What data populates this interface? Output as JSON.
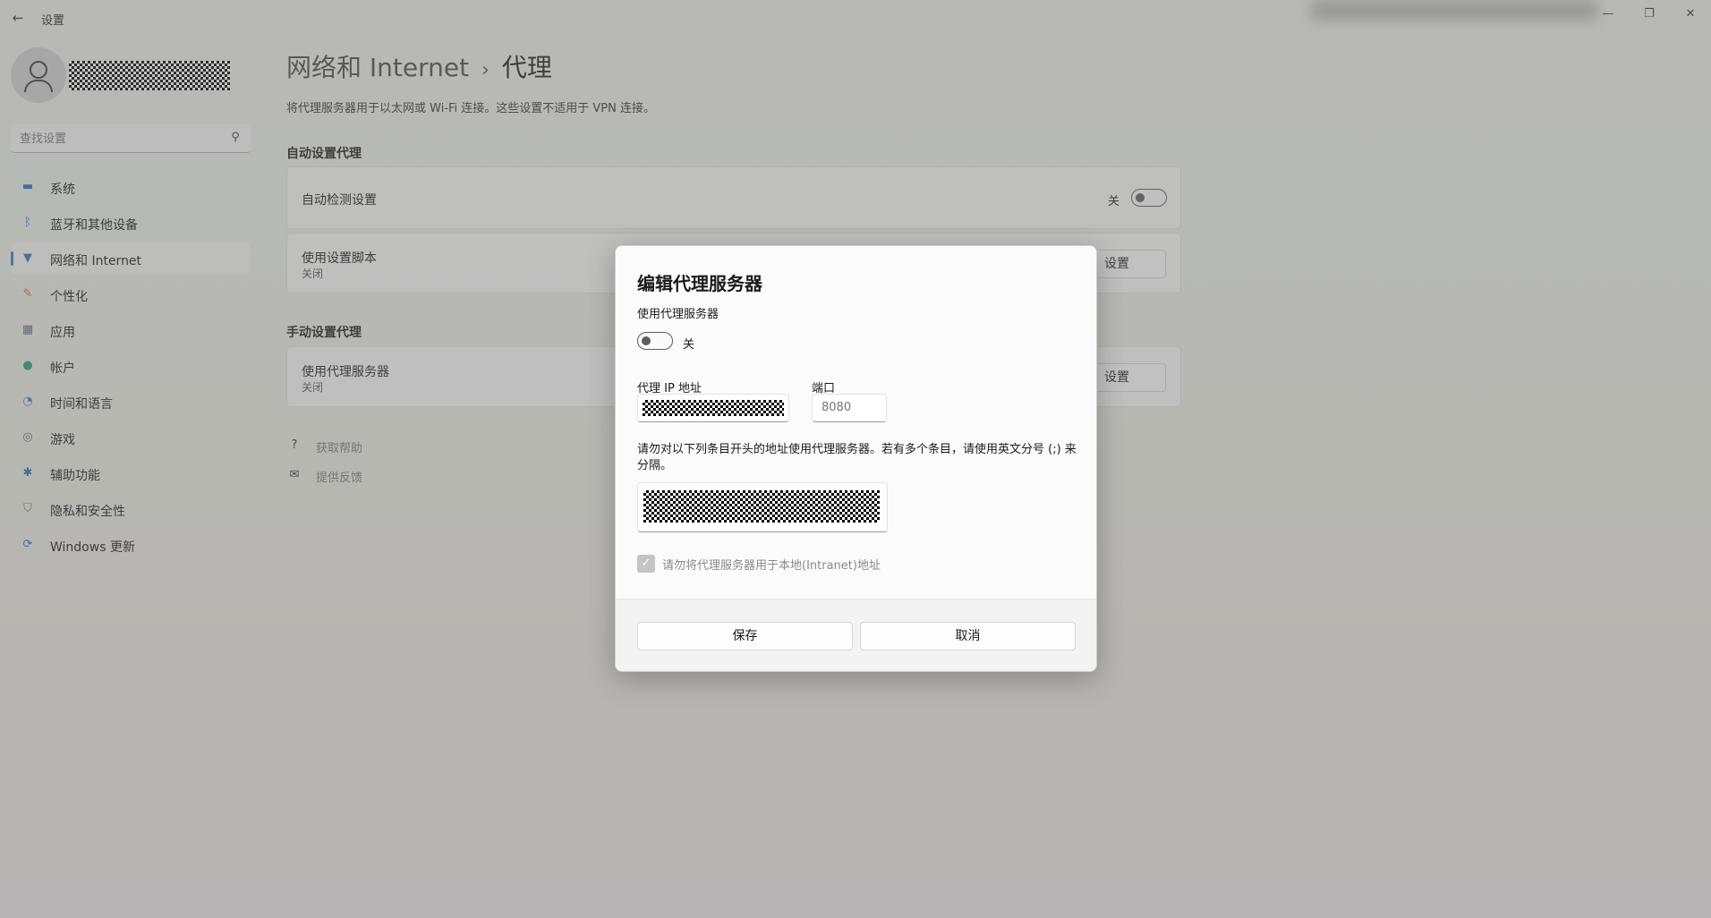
{
  "window": {
    "title": "设置",
    "back_icon": "←",
    "minimize_icon": "—",
    "maximize_icon": "❐",
    "close_icon": "✕"
  },
  "sidebar": {
    "search_placeholder": "查找设置",
    "items": [
      {
        "label": "系统",
        "icon": "system-icon",
        "glyph": "▬",
        "color": "#1a73c8"
      },
      {
        "label": "蓝牙和其他设备",
        "icon": "bluetooth-icon",
        "glyph": "ᛒ",
        "color": "#1a73c8"
      },
      {
        "label": "网络和 Internet",
        "icon": "wifi-icon",
        "glyph": "▼",
        "color": "#3a6fb0",
        "active": true
      },
      {
        "label": "个性化",
        "icon": "brush-icon",
        "glyph": "✎",
        "color": "#c07a2a"
      },
      {
        "label": "应用",
        "icon": "apps-icon",
        "glyph": "▦",
        "color": "#5a6a7a"
      },
      {
        "label": "帐户",
        "icon": "account-icon",
        "glyph": "●",
        "color": "#2a9a7a"
      },
      {
        "label": "时间和语言",
        "icon": "globe-clock-icon",
        "glyph": "◔",
        "color": "#3a7dc9"
      },
      {
        "label": "游戏",
        "icon": "gamepad-icon",
        "glyph": "◎",
        "color": "#6a6a6a"
      },
      {
        "label": "辅助功能",
        "icon": "accessibility-icon",
        "glyph": "✱",
        "color": "#2a6ab0"
      },
      {
        "label": "隐私和安全性",
        "icon": "shield-icon",
        "glyph": "⛉",
        "color": "#6a6a6a"
      },
      {
        "label": "Windows 更新",
        "icon": "update-icon",
        "glyph": "⟳",
        "color": "#1a73c8"
      }
    ]
  },
  "main": {
    "breadcrumb_parent": "网络和 Internet",
    "breadcrumb_sep": "›",
    "breadcrumb_current": "代理",
    "description": "将代理服务器用于以太网或 Wi-Fi 连接。这些设置不适用于 VPN 连接。",
    "auto_section": "自动设置代理",
    "auto_detect_label": "自动检测设置",
    "auto_detect_state": "关",
    "script_label": "使用设置脚本",
    "script_sub": "关闭",
    "script_button": "设置",
    "manual_section": "手动设置代理",
    "proxy_label": "使用代理服务器",
    "proxy_sub": "关闭",
    "proxy_button": "设置",
    "help_link": "获取帮助",
    "feedback_link": "提供反馈"
  },
  "dialog": {
    "title": "编辑代理服务器",
    "use_proxy_label": "使用代理服务器",
    "use_proxy_state": "关",
    "ip_label": "代理 IP 地址",
    "port_label": "端口",
    "port_value": "8080",
    "note": "请勿对以下列条目开头的地址使用代理服务器。若有多个条目，请使用英文分号 (;) 来分隔。",
    "local_checkbox_label": "请勿将代理服务器用于本地(Intranet)地址",
    "local_checked": true,
    "save_label": "保存",
    "cancel_label": "取消"
  }
}
